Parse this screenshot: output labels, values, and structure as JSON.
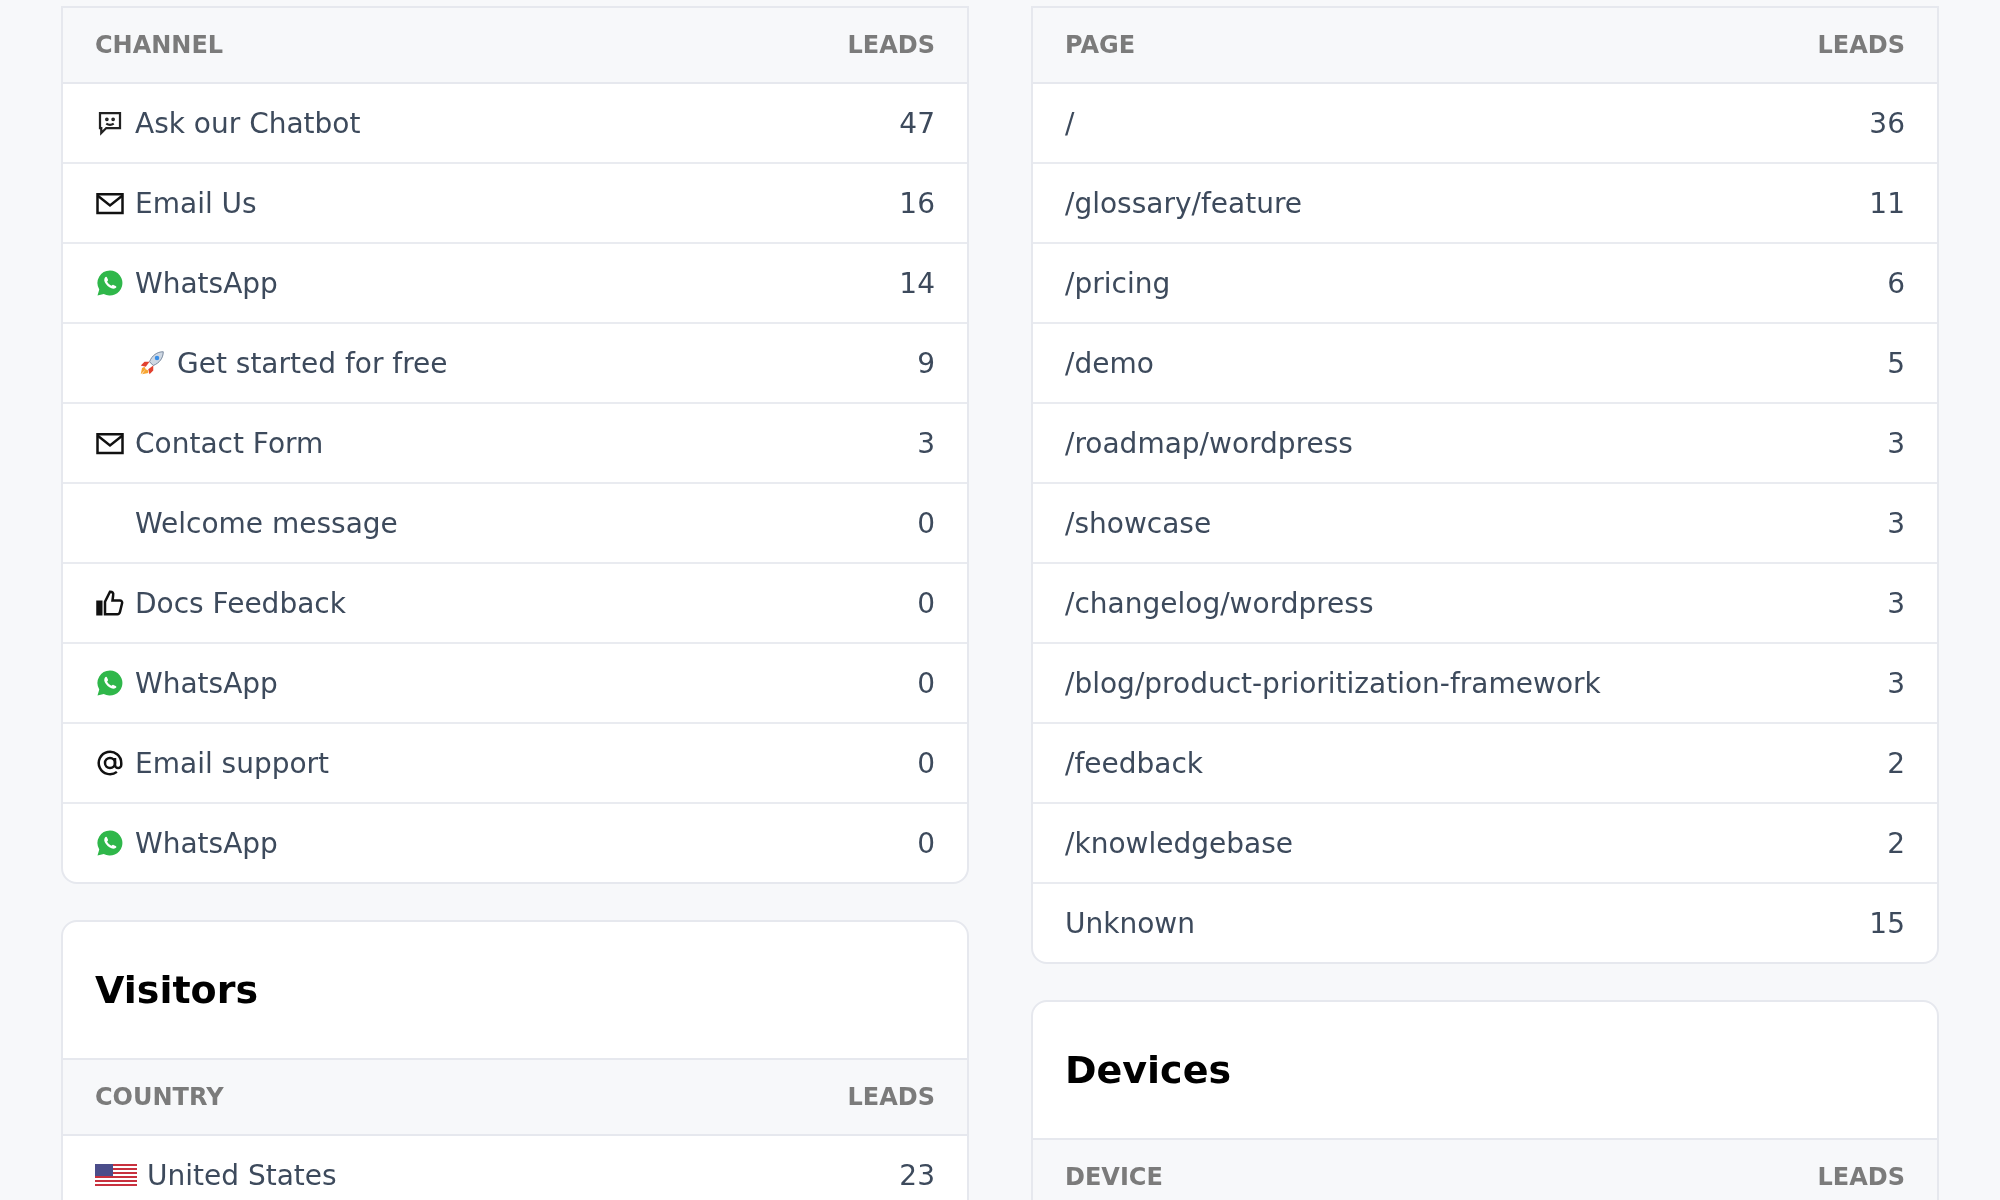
{
  "channels": {
    "columns": [
      "CHANNEL",
      "LEADS"
    ],
    "rows": [
      {
        "kind": "chatbot",
        "label": "Ask our Chatbot",
        "leads": "47"
      },
      {
        "kind": "mail",
        "label": "Email Us",
        "leads": "16"
      },
      {
        "kind": "whatsapp",
        "label": "WhatsApp",
        "leads": "14",
        "children": [
          {
            "kind": "rocket",
            "label": "Get started for free",
            "leads": "9"
          }
        ]
      },
      {
        "kind": "mail",
        "label": "Contact Form",
        "leads": "3"
      },
      {
        "kind": "none",
        "label": "Welcome message",
        "leads": "0"
      },
      {
        "kind": "thumbs-up",
        "label": "Docs Feedback",
        "leads": "0"
      },
      {
        "kind": "whatsapp",
        "label": "WhatsApp",
        "leads": "0"
      },
      {
        "kind": "at",
        "label": "Email support",
        "leads": "0"
      },
      {
        "kind": "whatsapp",
        "label": "WhatsApp",
        "leads": "0"
      }
    ]
  },
  "visitors": {
    "title": "Visitors",
    "columns": [
      "COUNTRY",
      "LEADS"
    ],
    "rows": [
      {
        "kind": "us-flag",
        "label": "United States",
        "leads": "23"
      }
    ]
  },
  "pages": {
    "columns": [
      "PAGE",
      "LEADS"
    ],
    "rows": [
      {
        "label": "/",
        "leads": "36"
      },
      {
        "label": "/glossary/feature",
        "leads": "11"
      },
      {
        "label": "/pricing",
        "leads": "6"
      },
      {
        "label": "/demo",
        "leads": "5"
      },
      {
        "label": "/roadmap/wordpress",
        "leads": "3"
      },
      {
        "label": "/showcase",
        "leads": "3"
      },
      {
        "label": "/changelog/wordpress",
        "leads": "3"
      },
      {
        "label": "/blog/product-prioritization-framework",
        "leads": "3"
      },
      {
        "label": "/feedback",
        "leads": "2"
      },
      {
        "label": "/knowledgebase",
        "leads": "2"
      },
      {
        "label": "Unknown",
        "leads": "15"
      }
    ]
  },
  "devices": {
    "title": "Devices",
    "columns": [
      "DEVICE",
      "LEADS"
    ]
  }
}
